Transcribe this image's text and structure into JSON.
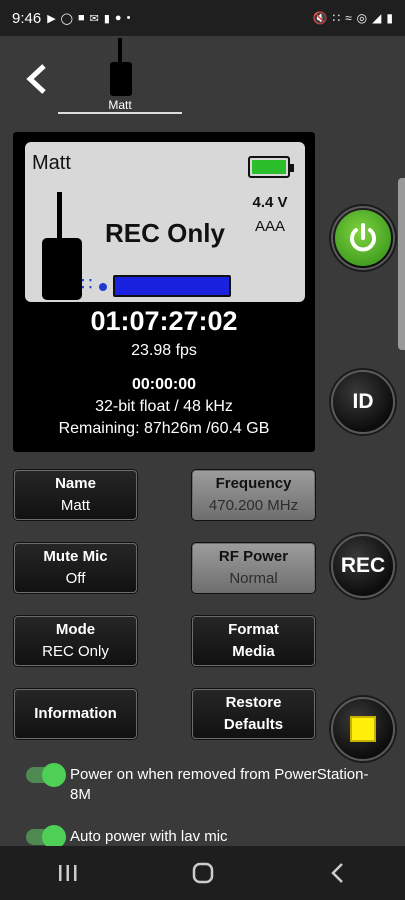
{
  "status_bar": {
    "time": "9:46",
    "notification_icons": [
      "youtube-icon",
      "circle-icon",
      "tmobile-icon",
      "gmail-icon",
      "netflix-icon",
      "pinterest-icon",
      "dot-icon"
    ],
    "right_icons": [
      "mute-icon",
      "bluetooth-icon",
      "wifi-icon",
      "hotspot-icon",
      "signal-icon",
      "battery-charging-icon"
    ]
  },
  "header": {
    "back_icon": "chevron-left-icon",
    "transmitter_name": "Matt"
  },
  "display": {
    "lcd_name": "Matt",
    "battery_color": "#2bbf2b",
    "voltage": "4.4 V",
    "battery_type": "AAA",
    "mode": "REC Only",
    "meter_color": "#1a22e0",
    "timecode": "01:07:27:02",
    "fps": "23.98 fps",
    "record_time": "00:00:00",
    "format": "32-bit float / 48 kHz",
    "remaining": "Remaining: 87h26m /60.4 GB"
  },
  "side_buttons": {
    "power_icon": "power-icon",
    "id_label": "ID",
    "rec_label": "REC",
    "stop_icon": "stop-square-icon"
  },
  "controls": {
    "name": {
      "title": "Name",
      "value": "Matt"
    },
    "frequency": {
      "title": "Frequency",
      "value": "470.200 MHz"
    },
    "mute_mic": {
      "title": "Mute Mic",
      "value": "Off"
    },
    "rf_power": {
      "title": "RF Power",
      "value": "Normal"
    },
    "mode": {
      "title": "Mode",
      "value": "REC Only"
    },
    "format_media": {
      "line1": "Format",
      "line2": "Media"
    },
    "information": {
      "title": "Information"
    },
    "restore_defaults": {
      "line1": "Restore",
      "line2": "Defaults"
    }
  },
  "toggles": [
    {
      "label": "Power on when removed from PowerStation-8M",
      "on": true
    },
    {
      "label": "Auto power with lav mic",
      "on": true
    }
  ],
  "nav_bar": {
    "recents_icon": "recents-icon",
    "home_icon": "home-icon",
    "back_icon": "back-icon"
  }
}
